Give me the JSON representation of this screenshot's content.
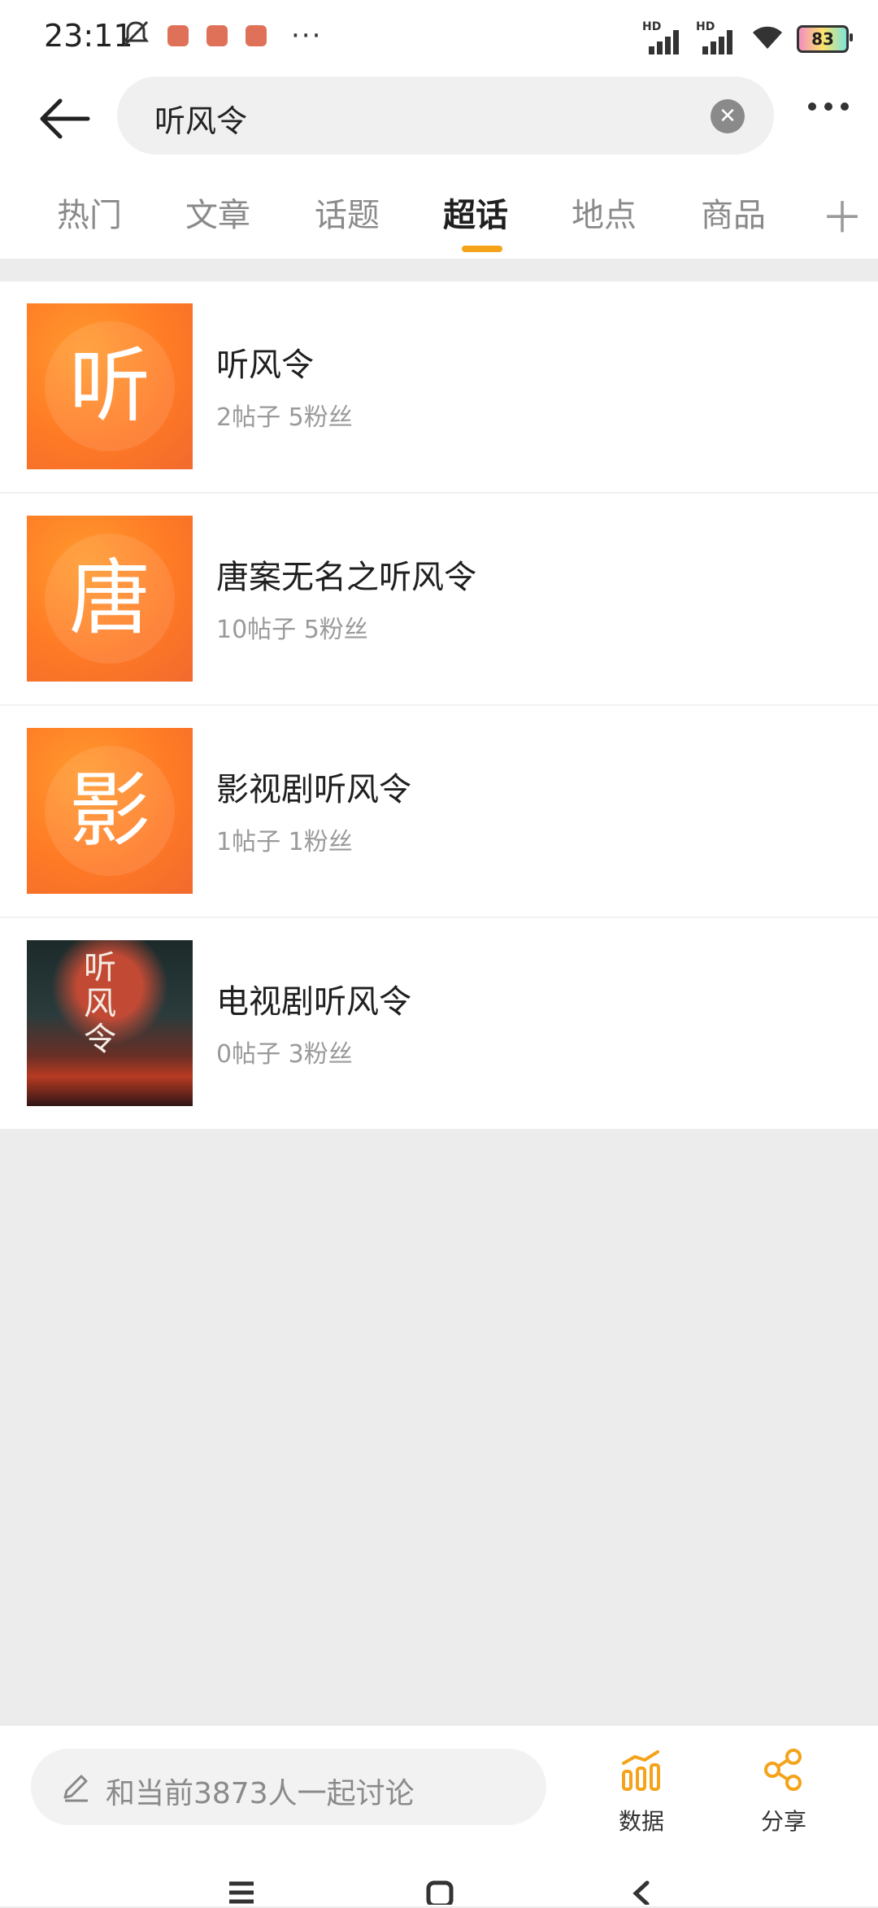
{
  "status": {
    "time": "23:11",
    "battery": "83"
  },
  "search": {
    "query": "听风令"
  },
  "tabs": [
    "热门",
    "文章",
    "话题",
    "超话",
    "地点",
    "商品"
  ],
  "active_tab": "超话",
  "results": [
    {
      "glyph": "听",
      "title": "听风令",
      "meta": "2帖子 5粉丝"
    },
    {
      "glyph": "唐",
      "title": "唐案无名之听风令",
      "meta": "10帖子 5粉丝"
    },
    {
      "glyph": "影",
      "title": "影视剧听风令",
      "meta": "1帖子 1粉丝"
    },
    {
      "poster_text": "听风令",
      "title": "电视剧听风令",
      "meta": "0帖子 3粉丝"
    }
  ],
  "bottom": {
    "discuss_placeholder": "和当前3873人一起讨论",
    "data_label": "数据",
    "share_label": "分享"
  },
  "colors": {
    "accent": "#f4a31a",
    "brand_orange": "#ff7a25",
    "divider": "#ececec"
  }
}
